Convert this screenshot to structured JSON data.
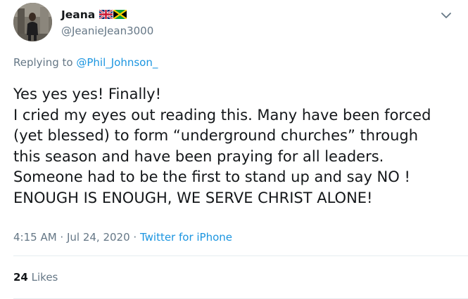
{
  "user": {
    "display_name": "Jeana",
    "handle": "@JeanieJean3000",
    "flags": [
      "uk-flag-icon",
      "jamaica-flag-icon"
    ]
  },
  "reply": {
    "prefix": "Replying to ",
    "mention": "@Phil_Johnson_"
  },
  "body": {
    "lines": [
      "Yes yes yes! Finally!",
      "I cried my eyes out reading this. Many have been forced",
      "(yet blessed) to form “underground churches” through",
      "this season and have been praying for all leaders.",
      "Someone had to be the first to stand up and say NO !",
      "ENOUGH IS ENOUGH, WE SERVE CHRIST ALONE!"
    ]
  },
  "meta": {
    "time": "4:15 AM",
    "separator1": " · ",
    "date": "Jul 24, 2020",
    "separator2": " · ",
    "source": "Twitter for iPhone"
  },
  "stats": {
    "likes_count": "24",
    "likes_label": "Likes"
  },
  "colors": {
    "link": "#1b95e0",
    "secondary_text": "#657786",
    "primary_text": "#14171a",
    "divider": "#e6ecf0"
  }
}
